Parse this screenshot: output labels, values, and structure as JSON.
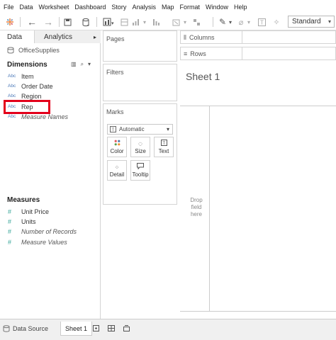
{
  "menu": [
    "File",
    "Data",
    "Worksheet",
    "Dashboard",
    "Story",
    "Analysis",
    "Map",
    "Format",
    "Window",
    "Help"
  ],
  "toolbar": {
    "fit_label": "Standard",
    "icons": [
      "tableau-logo-icon",
      "new-worksheet-icon",
      "undo-icon",
      "redo-icon",
      "save-icon",
      "new-datasource-icon",
      "chart-icon",
      "swap-icon",
      "sort-ascending-icon",
      "sort-descending-icon",
      "highlight-icon",
      "annotate-icon",
      "text-icon",
      "pin-icon"
    ]
  },
  "data_panel": {
    "tab_data": "Data",
    "tab_analytics": "Analytics",
    "analytics_caret": "▸",
    "datasource": "OfficeSupplies",
    "dimensions_header": "Dimensions",
    "dimensions": [
      {
        "type": "Abc",
        "label": "Item"
      },
      {
        "type": "Abc",
        "label": "Order Date"
      },
      {
        "type": "Abc",
        "label": "Region"
      },
      {
        "type": "Abc",
        "label": "Rep"
      },
      {
        "type": "Abc",
        "label": "Measure Names"
      }
    ],
    "measures_header": "Measures",
    "measures": [
      {
        "type": "#",
        "label": "Unit Price"
      },
      {
        "type": "#",
        "label": "Units"
      },
      {
        "type": "#",
        "label": "Number of Records"
      },
      {
        "type": "#",
        "label": "Measure Values"
      }
    ]
  },
  "shelves": {
    "pages": "Pages",
    "filters": "Filters",
    "marks": "Marks",
    "marks_type": "Automatic",
    "mark_buttons": [
      "Color",
      "Size",
      "Text",
      "Detail",
      "Tooltip"
    ],
    "columns": "Columns",
    "rows": "Rows"
  },
  "view": {
    "title": "Sheet 1",
    "drop_text": "Drop field here"
  },
  "bottom": {
    "data_source": "Data Source",
    "sheet": "Sheet 1"
  }
}
